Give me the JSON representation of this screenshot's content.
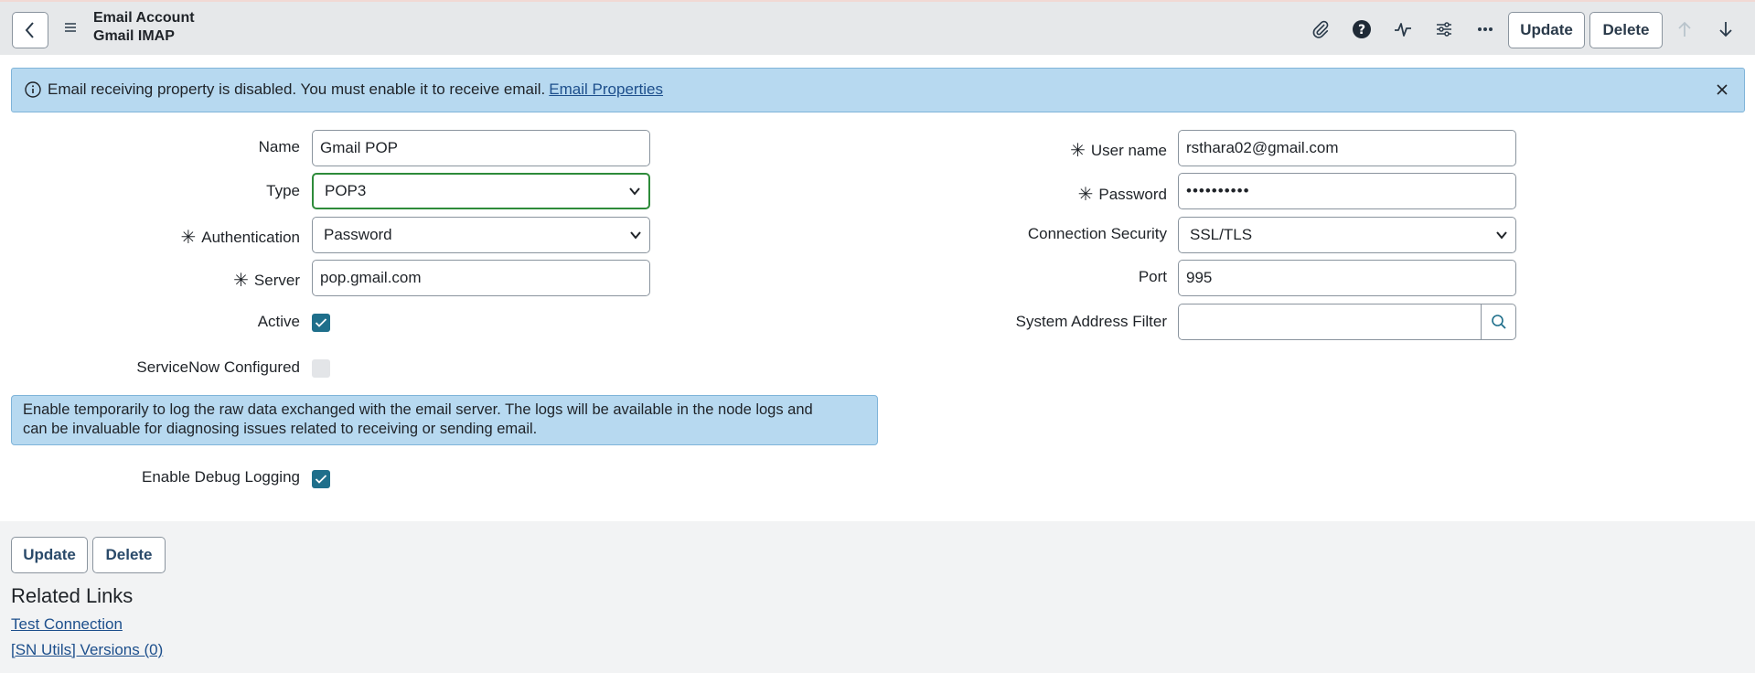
{
  "header": {
    "title_line1": "Email Account",
    "title_line2": "Gmail IMAP",
    "update_label": "Update",
    "delete_label": "Delete"
  },
  "alert": {
    "message": "Email receiving property is disabled. You must enable it to receive email.",
    "link": "Email Properties"
  },
  "form": {
    "name_label": "Name",
    "name_value": "Gmail POP",
    "type_label": "Type",
    "type_value": "POP3",
    "auth_label": "Authentication",
    "auth_value": "Password",
    "server_label": "Server",
    "server_value": "pop.gmail.com",
    "active_label": "Active",
    "snc_label": "ServiceNow Configured",
    "username_label": "User name",
    "username_value": "rsthara02@gmail.com",
    "password_label": "Password",
    "password_value": "••••••••••",
    "conn_sec_label": "Connection Security",
    "conn_sec_value": "SSL/TLS",
    "port_label": "Port",
    "port_value": "995",
    "sys_addr_label": "System Address Filter",
    "sys_addr_value": "",
    "debug_info_line1": "Enable temporarily to log the raw data exchanged with the email server. The logs will be available in the node logs and",
    "debug_info_line2": "can be invaluable for diagnosing issues related to receiving or sending email.",
    "debug_label": "Enable Debug Logging"
  },
  "footer": {
    "update_label": "Update",
    "delete_label": "Delete",
    "related_title": "Related Links",
    "links": [
      "Test Connection",
      "[SN Utils] Versions (0)"
    ]
  },
  "colors": {
    "accent": "#1f6f8b",
    "alert_bg": "#b7d9f0",
    "focus_border": "#2e8b3a"
  }
}
